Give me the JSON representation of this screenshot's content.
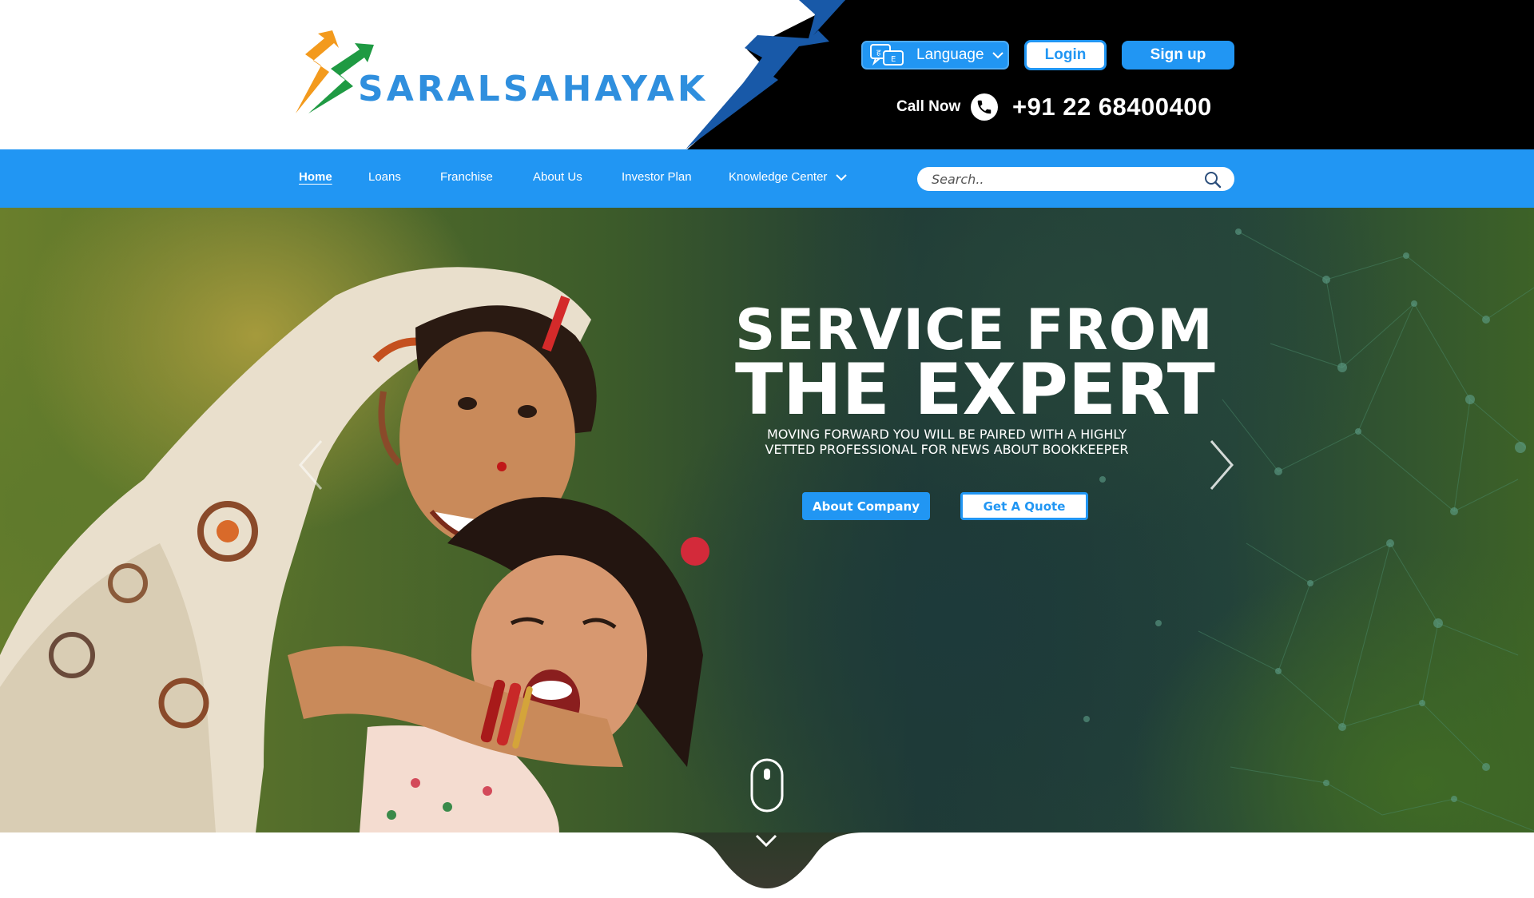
{
  "brand": {
    "name": "SARALSAHAYAK",
    "colors": {
      "primary": "#2196f3",
      "logo_orange": "#f39a1d",
      "logo_green": "#1f9a43",
      "logo_text": "#2f8fde",
      "header_dark": "#000000",
      "accent_dark_blue": "#1859a8"
    }
  },
  "header": {
    "language_label": "Language",
    "language_icon": "translate-icon",
    "login_label": "Login",
    "signup_label": "Sign up",
    "call_label": "Call Now",
    "phone_icon": "phone-icon",
    "phone_number": "+91 22 68400400"
  },
  "nav": {
    "items": [
      {
        "label": "Home",
        "active": true
      },
      {
        "label": "Loans",
        "active": false
      },
      {
        "label": "Franchise",
        "active": false
      },
      {
        "label": "About Us",
        "active": false
      },
      {
        "label": "Investor Plan",
        "active": false
      },
      {
        "label": "Knowledge Center",
        "active": false,
        "has_dropdown": true
      }
    ],
    "search_placeholder": "Search..",
    "search_icon": "search-icon"
  },
  "hero": {
    "title_line1": "SERVICE FROM",
    "title_line2": "THE EXPERT",
    "subtitle": "MOVING FORWARD YOU WILL BE PAIRED WITH A HIGHLY VETTED PROFESSIONAL FOR NEWS ABOUT BOOKKEEPER",
    "primary_button": "About Company",
    "secondary_button": "Get A Quote",
    "prev_icon": "chevron-left-icon",
    "next_icon": "chevron-right-icon",
    "scroll_icon": "mouse-icon",
    "scroll_down_icon": "chevron-down-icon"
  }
}
